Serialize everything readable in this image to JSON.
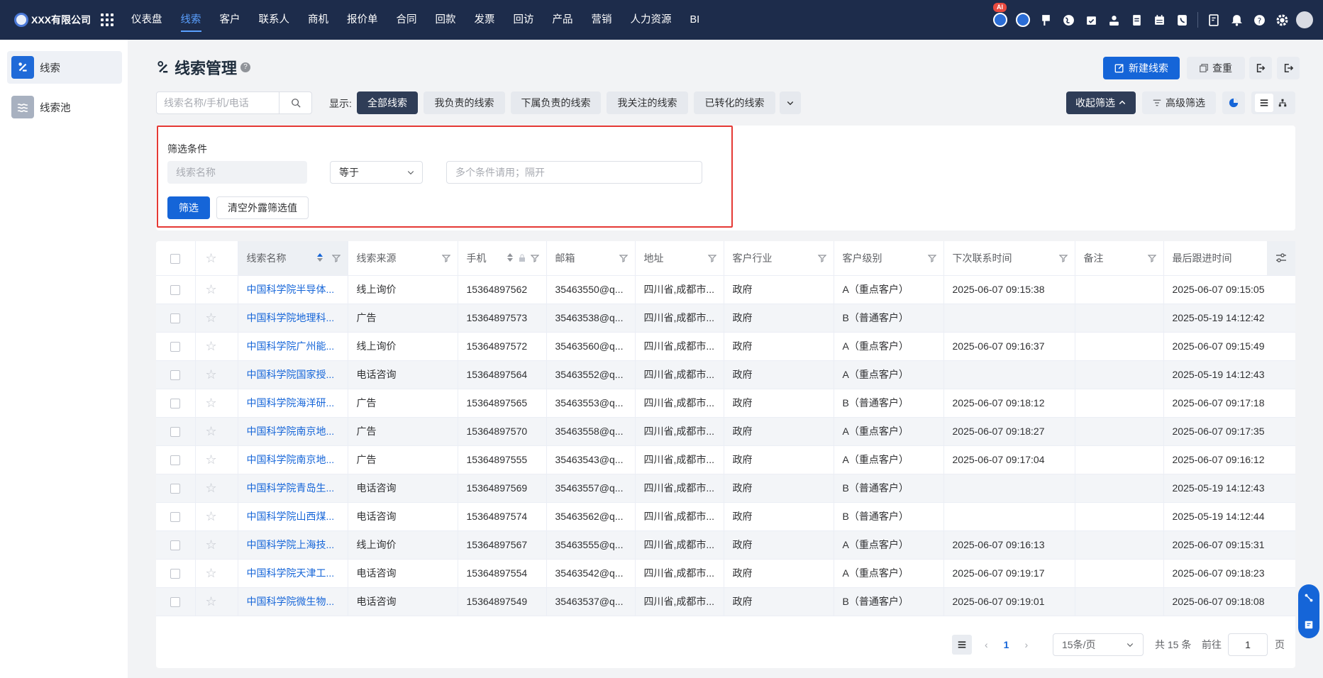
{
  "app": {
    "company": "XXX有限公司",
    "ai_badge": "AI"
  },
  "nav": [
    {
      "label": "仪表盘"
    },
    {
      "label": "线索"
    },
    {
      "label": "客户"
    },
    {
      "label": "联系人"
    },
    {
      "label": "商机"
    },
    {
      "label": "报价单"
    },
    {
      "label": "合同"
    },
    {
      "label": "回款"
    },
    {
      "label": "发票"
    },
    {
      "label": "回访"
    },
    {
      "label": "产品"
    },
    {
      "label": "营销"
    },
    {
      "label": "人力资源"
    },
    {
      "label": "BI"
    }
  ],
  "nav_active_index": 1,
  "top_icons": [
    "robot-ai-icon",
    "chat-icon",
    "flag-icon",
    "globe-icon",
    "check-calendar-icon",
    "user-icon",
    "document-icon",
    "calendar-icon",
    "phone-icon",
    "sep",
    "report-icon",
    "bell-icon",
    "help-icon",
    "gear-icon",
    "avatar"
  ],
  "sidebar": {
    "items": [
      {
        "label": "线索",
        "active": true
      },
      {
        "label": "线索池",
        "active": false
      }
    ]
  },
  "header": {
    "title": "线索管理",
    "new_button": "新建线索",
    "dedupe_button": "查重"
  },
  "toolbar": {
    "search_placeholder": "线索名称/手机/电话",
    "show_label": "显示:",
    "chips": [
      "全部线索",
      "我负责的线索",
      "下属负责的线索",
      "我关注的线索",
      "已转化的线索"
    ],
    "collapse_filter": "收起筛选",
    "advanced_filter": "高级筛选"
  },
  "filter": {
    "title": "筛选条件",
    "field_placeholder": "线索名称",
    "operator": "等于",
    "value_placeholder": "多个条件请用；隔开",
    "apply": "筛选",
    "clear": "清空外露筛选值"
  },
  "table": {
    "columns": [
      "线索名称",
      "线索来源",
      "手机",
      "邮箱",
      "地址",
      "客户行业",
      "客户级别",
      "下次联系时间",
      "备注",
      "最后跟进时间"
    ],
    "rows": [
      [
        "中国科学院半导体...",
        "线上询价",
        "15364897562",
        "35463550@q...",
        "四川省,成都市...",
        "政府",
        "A（重点客户）",
        "2025-06-07 09:15:38",
        "",
        "2025-06-07 09:15:05"
      ],
      [
        "中国科学院地理科...",
        "广告",
        "15364897573",
        "35463538@q...",
        "四川省,成都市...",
        "政府",
        "B（普通客户）",
        "",
        "",
        "2025-05-19 14:12:42"
      ],
      [
        "中国科学院广州能...",
        "线上询价",
        "15364897572",
        "35463560@q...",
        "四川省,成都市...",
        "政府",
        "A（重点客户）",
        "2025-06-07 09:16:37",
        "",
        "2025-06-07 09:15:49"
      ],
      [
        "中国科学院国家授...",
        "电话咨询",
        "15364897564",
        "35463552@q...",
        "四川省,成都市...",
        "政府",
        "A（重点客户）",
        "",
        "",
        "2025-05-19 14:12:43"
      ],
      [
        "中国科学院海洋研...",
        "广告",
        "15364897565",
        "35463553@q...",
        "四川省,成都市...",
        "政府",
        "B（普通客户）",
        "2025-06-07 09:18:12",
        "",
        "2025-06-07 09:17:18"
      ],
      [
        "中国科学院南京地...",
        "广告",
        "15364897570",
        "35463558@q...",
        "四川省,成都市...",
        "政府",
        "A（重点客户）",
        "2025-06-07 09:18:27",
        "",
        "2025-06-07 09:17:35"
      ],
      [
        "中国科学院南京地...",
        "广告",
        "15364897555",
        "35463543@q...",
        "四川省,成都市...",
        "政府",
        "A（重点客户）",
        "2025-06-07 09:17:04",
        "",
        "2025-06-07 09:16:12"
      ],
      [
        "中国科学院青岛生...",
        "电话咨询",
        "15364897569",
        "35463557@q...",
        "四川省,成都市...",
        "政府",
        "B（普通客户）",
        "",
        "",
        "2025-05-19 14:12:43"
      ],
      [
        "中国科学院山西煤...",
        "电话咨询",
        "15364897574",
        "35463562@q...",
        "四川省,成都市...",
        "政府",
        "B（普通客户）",
        "",
        "",
        "2025-05-19 14:12:44"
      ],
      [
        "中国科学院上海技...",
        "线上询价",
        "15364897567",
        "35463555@q...",
        "四川省,成都市...",
        "政府",
        "A（重点客户）",
        "2025-06-07 09:16:13",
        "",
        "2025-06-07 09:15:31"
      ],
      [
        "中国科学院天津工...",
        "电话咨询",
        "15364897554",
        "35463542@q...",
        "四川省,成都市...",
        "政府",
        "A（重点客户）",
        "2025-06-07 09:19:17",
        "",
        "2025-06-07 09:18:23"
      ],
      [
        "中国科学院微生物...",
        "电话咨询",
        "15364897549",
        "35463537@q...",
        "四川省,成都市...",
        "政府",
        "B（普通客户）",
        "2025-06-07 09:19:01",
        "",
        "2025-06-07 09:18:08"
      ]
    ]
  },
  "pagination": {
    "current_page": "1",
    "page_size": "15条/页",
    "total": "共 15 条",
    "goto_label": "前往",
    "goto_value": "1",
    "page_suffix": "页"
  },
  "colors": {
    "topbar": "#1d2c4b",
    "primary": "#1565d8",
    "dark_chip": "#2f3d57",
    "highlight_border": "#e53935"
  }
}
